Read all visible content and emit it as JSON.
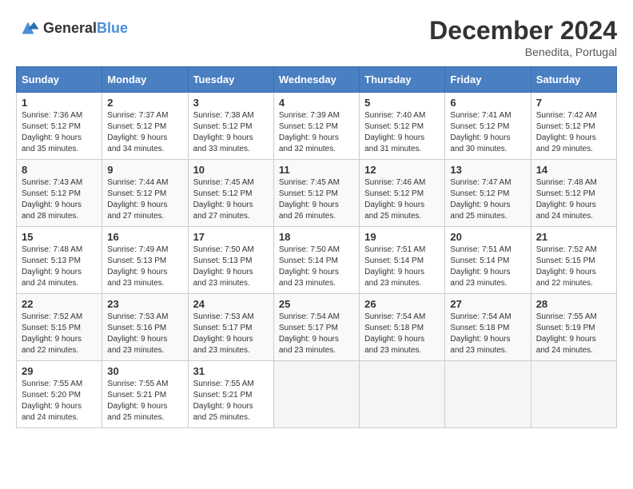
{
  "header": {
    "logo_general": "General",
    "logo_blue": "Blue",
    "month_title": "December 2024",
    "location": "Benedita, Portugal"
  },
  "days_of_week": [
    "Sunday",
    "Monday",
    "Tuesday",
    "Wednesday",
    "Thursday",
    "Friday",
    "Saturday"
  ],
  "weeks": [
    [
      {
        "day": "1",
        "sunrise": "Sunrise: 7:36 AM",
        "sunset": "Sunset: 5:12 PM",
        "daylight": "Daylight: 9 hours and 35 minutes."
      },
      {
        "day": "2",
        "sunrise": "Sunrise: 7:37 AM",
        "sunset": "Sunset: 5:12 PM",
        "daylight": "Daylight: 9 hours and 34 minutes."
      },
      {
        "day": "3",
        "sunrise": "Sunrise: 7:38 AM",
        "sunset": "Sunset: 5:12 PM",
        "daylight": "Daylight: 9 hours and 33 minutes."
      },
      {
        "day": "4",
        "sunrise": "Sunrise: 7:39 AM",
        "sunset": "Sunset: 5:12 PM",
        "daylight": "Daylight: 9 hours and 32 minutes."
      },
      {
        "day": "5",
        "sunrise": "Sunrise: 7:40 AM",
        "sunset": "Sunset: 5:12 PM",
        "daylight": "Daylight: 9 hours and 31 minutes."
      },
      {
        "day": "6",
        "sunrise": "Sunrise: 7:41 AM",
        "sunset": "Sunset: 5:12 PM",
        "daylight": "Daylight: 9 hours and 30 minutes."
      },
      {
        "day": "7",
        "sunrise": "Sunrise: 7:42 AM",
        "sunset": "Sunset: 5:12 PM",
        "daylight": "Daylight: 9 hours and 29 minutes."
      }
    ],
    [
      {
        "day": "8",
        "sunrise": "Sunrise: 7:43 AM",
        "sunset": "Sunset: 5:12 PM",
        "daylight": "Daylight: 9 hours and 28 minutes."
      },
      {
        "day": "9",
        "sunrise": "Sunrise: 7:44 AM",
        "sunset": "Sunset: 5:12 PM",
        "daylight": "Daylight: 9 hours and 27 minutes."
      },
      {
        "day": "10",
        "sunrise": "Sunrise: 7:45 AM",
        "sunset": "Sunset: 5:12 PM",
        "daylight": "Daylight: 9 hours and 27 minutes."
      },
      {
        "day": "11",
        "sunrise": "Sunrise: 7:45 AM",
        "sunset": "Sunset: 5:12 PM",
        "daylight": "Daylight: 9 hours and 26 minutes."
      },
      {
        "day": "12",
        "sunrise": "Sunrise: 7:46 AM",
        "sunset": "Sunset: 5:12 PM",
        "daylight": "Daylight: 9 hours and 25 minutes."
      },
      {
        "day": "13",
        "sunrise": "Sunrise: 7:47 AM",
        "sunset": "Sunset: 5:12 PM",
        "daylight": "Daylight: 9 hours and 25 minutes."
      },
      {
        "day": "14",
        "sunrise": "Sunrise: 7:48 AM",
        "sunset": "Sunset: 5:12 PM",
        "daylight": "Daylight: 9 hours and 24 minutes."
      }
    ],
    [
      {
        "day": "15",
        "sunrise": "Sunrise: 7:48 AM",
        "sunset": "Sunset: 5:13 PM",
        "daylight": "Daylight: 9 hours and 24 minutes."
      },
      {
        "day": "16",
        "sunrise": "Sunrise: 7:49 AM",
        "sunset": "Sunset: 5:13 PM",
        "daylight": "Daylight: 9 hours and 23 minutes."
      },
      {
        "day": "17",
        "sunrise": "Sunrise: 7:50 AM",
        "sunset": "Sunset: 5:13 PM",
        "daylight": "Daylight: 9 hours and 23 minutes."
      },
      {
        "day": "18",
        "sunrise": "Sunrise: 7:50 AM",
        "sunset": "Sunset: 5:14 PM",
        "daylight": "Daylight: 9 hours and 23 minutes."
      },
      {
        "day": "19",
        "sunrise": "Sunrise: 7:51 AM",
        "sunset": "Sunset: 5:14 PM",
        "daylight": "Daylight: 9 hours and 23 minutes."
      },
      {
        "day": "20",
        "sunrise": "Sunrise: 7:51 AM",
        "sunset": "Sunset: 5:14 PM",
        "daylight": "Daylight: 9 hours and 23 minutes."
      },
      {
        "day": "21",
        "sunrise": "Sunrise: 7:52 AM",
        "sunset": "Sunset: 5:15 PM",
        "daylight": "Daylight: 9 hours and 22 minutes."
      }
    ],
    [
      {
        "day": "22",
        "sunrise": "Sunrise: 7:52 AM",
        "sunset": "Sunset: 5:15 PM",
        "daylight": "Daylight: 9 hours and 22 minutes."
      },
      {
        "day": "23",
        "sunrise": "Sunrise: 7:53 AM",
        "sunset": "Sunset: 5:16 PM",
        "daylight": "Daylight: 9 hours and 23 minutes."
      },
      {
        "day": "24",
        "sunrise": "Sunrise: 7:53 AM",
        "sunset": "Sunset: 5:17 PM",
        "daylight": "Daylight: 9 hours and 23 minutes."
      },
      {
        "day": "25",
        "sunrise": "Sunrise: 7:54 AM",
        "sunset": "Sunset: 5:17 PM",
        "daylight": "Daylight: 9 hours and 23 minutes."
      },
      {
        "day": "26",
        "sunrise": "Sunrise: 7:54 AM",
        "sunset": "Sunset: 5:18 PM",
        "daylight": "Daylight: 9 hours and 23 minutes."
      },
      {
        "day": "27",
        "sunrise": "Sunrise: 7:54 AM",
        "sunset": "Sunset: 5:18 PM",
        "daylight": "Daylight: 9 hours and 23 minutes."
      },
      {
        "day": "28",
        "sunrise": "Sunrise: 7:55 AM",
        "sunset": "Sunset: 5:19 PM",
        "daylight": "Daylight: 9 hours and 24 minutes."
      }
    ],
    [
      {
        "day": "29",
        "sunrise": "Sunrise: 7:55 AM",
        "sunset": "Sunset: 5:20 PM",
        "daylight": "Daylight: 9 hours and 24 minutes."
      },
      {
        "day": "30",
        "sunrise": "Sunrise: 7:55 AM",
        "sunset": "Sunset: 5:21 PM",
        "daylight": "Daylight: 9 hours and 25 minutes."
      },
      {
        "day": "31",
        "sunrise": "Sunrise: 7:55 AM",
        "sunset": "Sunset: 5:21 PM",
        "daylight": "Daylight: 9 hours and 25 minutes."
      },
      null,
      null,
      null,
      null
    ]
  ]
}
